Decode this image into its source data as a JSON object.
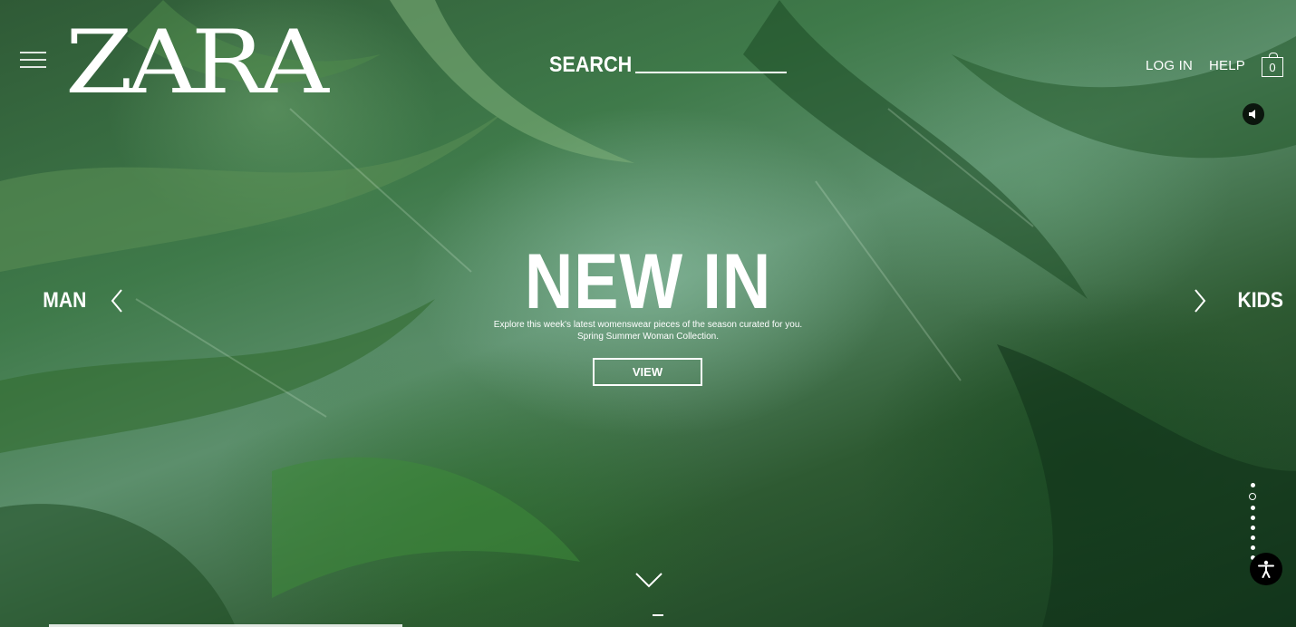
{
  "header": {
    "logo": "ZARA",
    "search_label": "SEARCH",
    "log_in": "LOG IN",
    "help": "HELP",
    "bag_count": "0"
  },
  "hero": {
    "title": "NEW IN",
    "subtitle_line1": "Explore this week's latest womenswear pieces of the season curated for you.",
    "subtitle_line2": "Spring Summer Woman Collection.",
    "view_label": "VIEW",
    "prev_section": "MAN",
    "next_section": "KIDS"
  },
  "slider": {
    "dot_count": 8,
    "active_index": 1
  },
  "icons": {
    "menu": "hamburger-menu-icon",
    "sound": "speaker-icon",
    "bag": "shopping-bag-icon",
    "prev": "chevron-left-icon",
    "next": "chevron-right-icon",
    "scroll": "chevron-down-icon",
    "accessibility": "accessibility-icon"
  },
  "colors": {
    "text": "#ffffff",
    "background_dark": "#153a1e",
    "background_mid": "#3f7a4a"
  }
}
